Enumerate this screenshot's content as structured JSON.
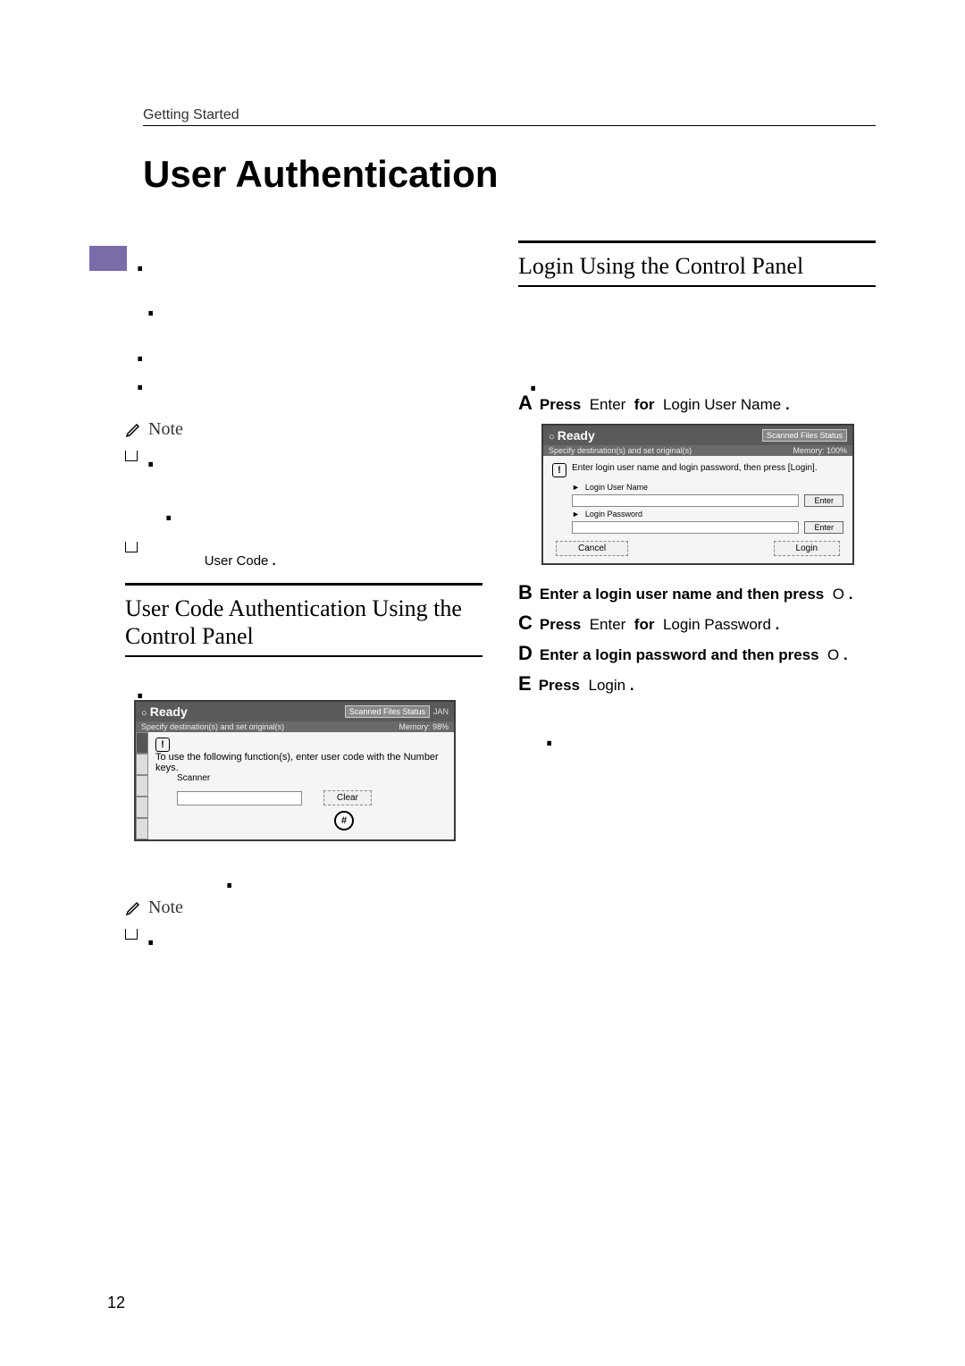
{
  "running_head": "Getting Started",
  "title": "User Authentication",
  "page_number": "12",
  "left": {
    "note_label": "Note",
    "user_code_ref": "User Code",
    "section_title": "User Code Authentication Using the Control Panel",
    "screenshot1": {
      "ready": "Ready",
      "status_btn": "Scanned Files Status",
      "subheader_left": "Specify destination(s) and set original(s)",
      "memory": "Memory:  98%",
      "msg": "To use the following function(s), enter user code with the Number keys.",
      "scanner_label": "Scanner",
      "clear": "Clear",
      "hash": "#",
      "jan": "JAN"
    },
    "note2_label": "Note"
  },
  "right": {
    "section_title": "Login Using the Control Panel",
    "steps": {
      "a_prefix": "A",
      "a_press": "Press",
      "a_enter": "Enter",
      "a_for": "for",
      "a_target": "Login User Name",
      "b_prefix": "B",
      "b_text": "Enter a login user name and then press",
      "b_ok": "O",
      "c_prefix": "C",
      "c_press": "Press",
      "c_enter": "Enter",
      "c_for": "for",
      "c_target": "Login Password",
      "d_prefix": "D",
      "d_text": "Enter a login password and then press",
      "d_ok": "O",
      "e_prefix": "E",
      "e_press": "Press",
      "e_login": "Login"
    },
    "screenshot2": {
      "ready": "Ready",
      "status_btn": "Scanned Files Status",
      "subheader_left": "Specify destination(s) and set original(s)",
      "memory": "Memory: 100%",
      "msg": "Enter login user name and login password, then press [Login].",
      "login_user_name": "Login User Name",
      "login_password": "Login Password",
      "enter": "Enter",
      "cancel": "Cancel",
      "login": "Login"
    }
  }
}
